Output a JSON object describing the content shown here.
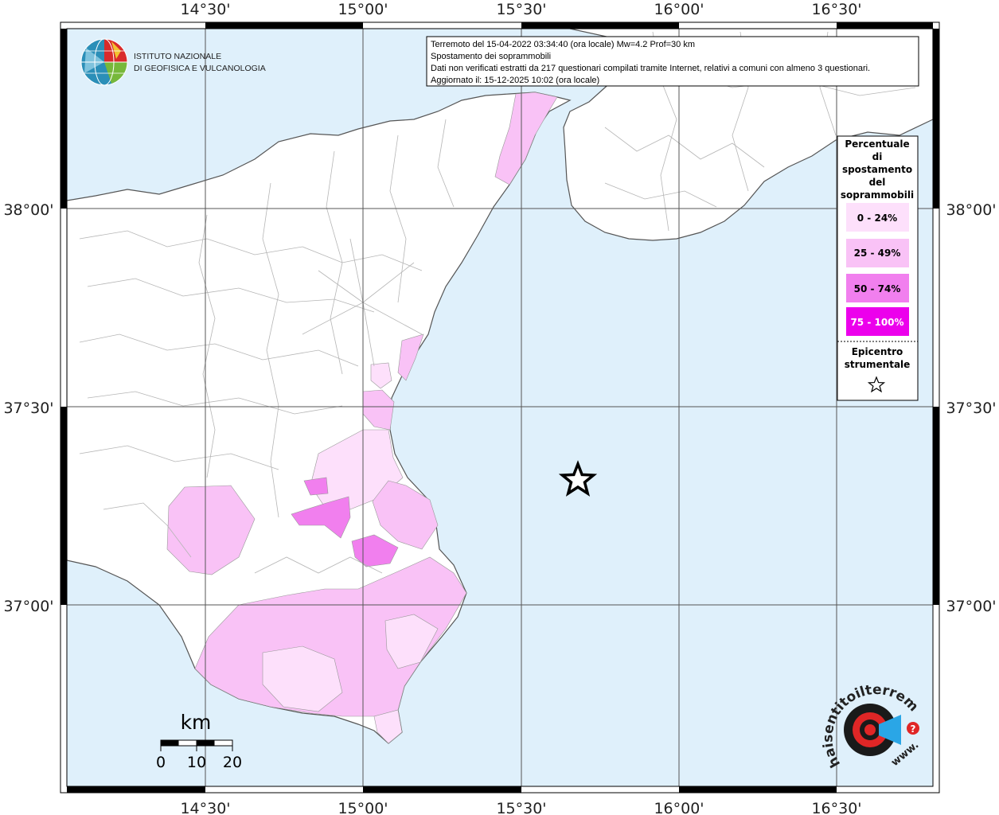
{
  "header": {
    "line1": "Terremoto del 15-04-2022 03:34:40 (ora locale) Mw=4.2 Prof=30 km",
    "line2": "Spostamento dei soprammobili",
    "line3": "Dati non verificati estratti da 217 questionari compilati tramite Internet, relativi a comuni con almeno 3 questionari.",
    "line4": "Aggiornato il: 15-12-2025 10:02 (ora locale)"
  },
  "institute": {
    "line1": "ISTITUTO NAZIONALE",
    "line2": "DI GEOFISICA E VULCANOLOGIA"
  },
  "axes": {
    "lon_ticks": [
      "14°30'",
      "15°00'",
      "15°30'",
      "16°00'",
      "16°30'"
    ],
    "lat_ticks": [
      "38°00'",
      "37°30'",
      "37°00'"
    ]
  },
  "legend": {
    "title_lines": [
      "Percentuale",
      "di",
      "spostamento",
      "del",
      "soprammobili"
    ],
    "classes": [
      {
        "label": "0 - 24%",
        "color": "#fde0fb"
      },
      {
        "label": "25 - 49%",
        "color": "#f9c2f6"
      },
      {
        "label": "50 - 74%",
        "color": "#f17fee"
      },
      {
        "label": "75 - 100%",
        "color": "#ec00ec"
      }
    ],
    "epicenter_lines": [
      "Epicentro",
      "strumentale"
    ]
  },
  "scale": {
    "unit": "km",
    "labels": [
      "0",
      "10",
      "20"
    ]
  },
  "logo": {
    "ring_text": "haisentitoilterremoto.it",
    "www": "www.",
    "badge": "?"
  },
  "colors": {
    "sea": "#dff0fb",
    "land": "#ffffff",
    "grid": "#555555",
    "boundary": "#b5b5b5"
  }
}
